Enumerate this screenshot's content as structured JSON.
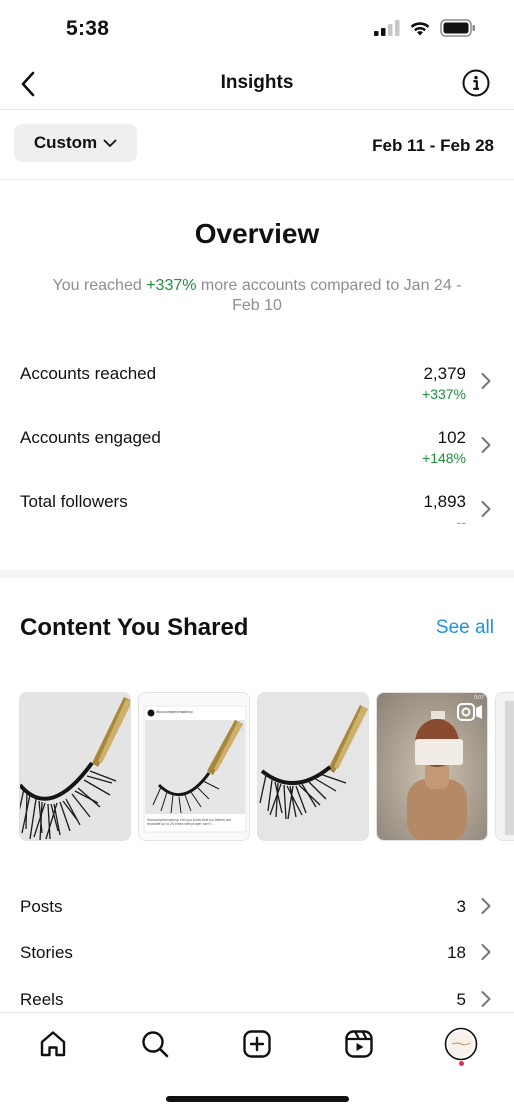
{
  "status": {
    "time": "5:38"
  },
  "header": {
    "title": "Insights"
  },
  "filter": {
    "custom_label": "Custom",
    "date_range": "Feb 11 - Feb 28"
  },
  "overview": {
    "title": "Overview",
    "subtitle_prefix": "You reached ",
    "subtitle_highlight": "+337%",
    "subtitle_suffix": " more accounts compared to Jan 24 - Feb 10",
    "metrics": [
      {
        "label": "Accounts reached",
        "value": "2,379",
        "change": "+337%"
      },
      {
        "label": "Accounts engaged",
        "value": "102",
        "change": "+148%"
      },
      {
        "label": "Total followers",
        "value": "1,893",
        "change": "--"
      }
    ]
  },
  "content": {
    "title": "Content You Shared",
    "see_all": "See all",
    "thumb_post_username": "ihoocomplexmakeup",
    "thumb_post_caption": "ihoocomplexmakeup Did you know that our lashes are reusable up to 25 times with proper care? ...",
    "thumb_reel_time": "0:07",
    "items": [
      {
        "label": "Posts",
        "count": "3"
      },
      {
        "label": "Stories",
        "count": "18"
      },
      {
        "label": "Reels",
        "count": "5"
      }
    ]
  },
  "colors": {
    "accent_link": "#1a95e0",
    "positive": "#1f8f3a",
    "notification": "#ed2a4f"
  },
  "tabs": [
    "home-icon",
    "search-icon",
    "create-icon",
    "reels-icon",
    "profile-avatar"
  ]
}
